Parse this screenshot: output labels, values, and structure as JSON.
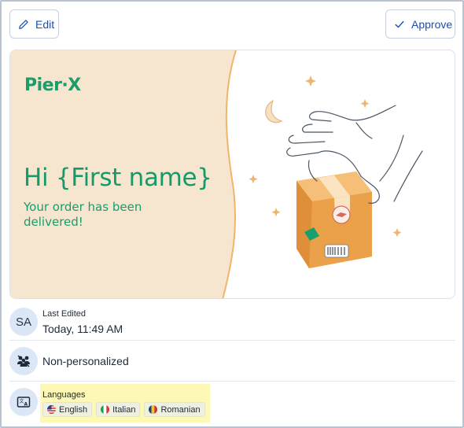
{
  "toolbar": {
    "edit_label": "Edit",
    "approve_label": "Approve"
  },
  "banner": {
    "logo": "Pier·X",
    "greeting": "Hi {First name}",
    "message": "Your order has been delivered!",
    "colors": {
      "brand_green": "#1a9c6b",
      "panel_beige": "#f7e7d0",
      "box_orange": "#f0a64e"
    }
  },
  "last_edited": {
    "initials": "SA",
    "label": "Last Edited",
    "value": "Today, 11:49 AM"
  },
  "personalization": {
    "icon": "audience-icon",
    "label": "Non-personalized"
  },
  "languages": {
    "icon": "translate-icon",
    "label": "Languages",
    "items": [
      {
        "name": "English",
        "flag": "us-flag-icon"
      },
      {
        "name": "Italian",
        "flag": "italy-flag-icon"
      },
      {
        "name": "Romanian",
        "flag": "romania-flag-icon"
      }
    ]
  }
}
